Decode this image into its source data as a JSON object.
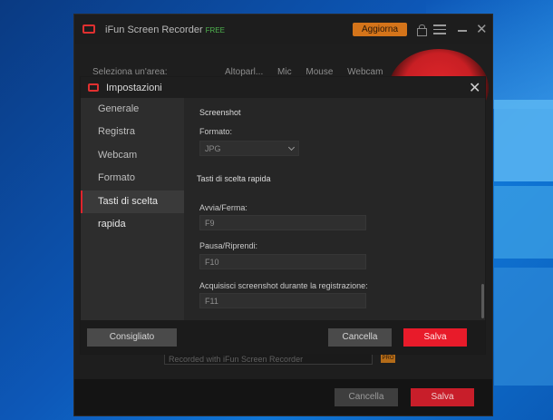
{
  "app": {
    "title": "iFun Screen Recorder",
    "edition": "FREE",
    "upgrade_label": "Aggiorna",
    "area_label": "Seleziona un'area:",
    "columns": [
      "Altoparl...",
      "Mic",
      "Mouse",
      "Webcam"
    ],
    "watermark_text": "Recorded with iFun Screen Recorder",
    "pro_badge": "PRO",
    "cancel_label": "Cancella",
    "save_label": "Salva"
  },
  "dialog": {
    "title": "Impostazioni",
    "nav": [
      {
        "label": "Generale"
      },
      {
        "label": "Registra"
      },
      {
        "label": "Webcam"
      },
      {
        "label": "Formato"
      },
      {
        "label": "Tasti di scelta rapida",
        "active": true
      }
    ],
    "screenshot_section": "Screenshot",
    "format_label": "Formato:",
    "format_value": "JPG",
    "hotkeys_section": "Tasti di scelta rapida",
    "hotkeys": [
      {
        "label": "Avvia/Ferma:",
        "value": "F9"
      },
      {
        "label": "Pausa/Riprendi:",
        "value": "F10"
      },
      {
        "label": "Acquisisci screenshot durante la registrazione:",
        "value": "F11"
      }
    ],
    "recommended_label": "Consigliato",
    "cancel_label": "Cancella",
    "save_label": "Salva"
  },
  "colors": {
    "accent_red": "#e81b2a",
    "upgrade_orange": "#d4741a",
    "free_green": "#4fb34f"
  }
}
